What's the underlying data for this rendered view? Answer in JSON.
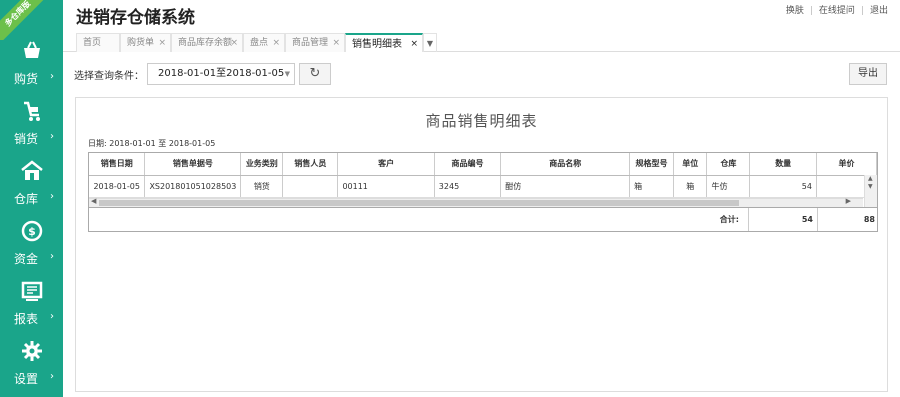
{
  "ribbon": "多仓库版",
  "app": {
    "title": "进销存仓储系统"
  },
  "top_links": [
    "换肤",
    "在线提问",
    "退出"
  ],
  "sidebar": {
    "items": [
      {
        "label": "购货",
        "icon": "basket-icon"
      },
      {
        "label": "销货",
        "icon": "cart-icon"
      },
      {
        "label": "仓库",
        "icon": "warehouse-icon"
      },
      {
        "label": "资金",
        "icon": "money-icon"
      },
      {
        "label": "报表",
        "icon": "report-icon"
      },
      {
        "label": "设置",
        "icon": "gear-icon"
      }
    ],
    "arrow": "›"
  },
  "tabs": [
    {
      "label": "首页"
    },
    {
      "label": "购货单"
    },
    {
      "label": "商品库存余额"
    },
    {
      "label": "盘点"
    },
    {
      "label": "商品管理"
    },
    {
      "label": "销售明细表",
      "active": true
    }
  ],
  "tab_close": "×",
  "filter": {
    "label": "选择查询条件：",
    "date_range": "2018-01-01至2018-01-05",
    "refresh": "↻",
    "export": "导出"
  },
  "report": {
    "title": "商品销售明细表",
    "date_line": "日期: 2018-01-01 至 2018-01-05",
    "columns": [
      "销售日期",
      "销售单据号",
      "业务类别",
      "销售人员",
      "客户",
      "商品编号",
      "商品名称",
      "规格型号",
      "单位",
      "仓库",
      "数量",
      "单价"
    ],
    "rows": [
      [
        "2018-01-05",
        "XS201801051028503",
        "销货",
        "",
        "00111",
        "3245",
        "酣仿",
        "",
        "箱",
        "箱",
        "牛仿",
        "54",
        ""
      ]
    ],
    "totals": {
      "label": "合计:",
      "quantity": "54",
      "price": "88"
    }
  }
}
